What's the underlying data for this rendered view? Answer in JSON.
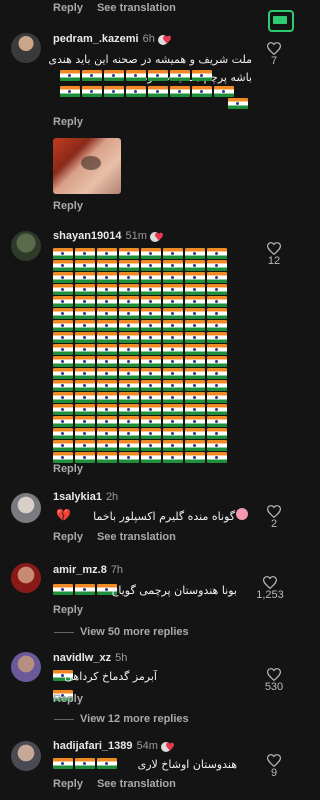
{
  "top": {
    "reply": "Reply",
    "see_translation": "See translation"
  },
  "comments": [
    {
      "username": "pedram_.kazemi",
      "time": "6h",
      "text_lines": [
        "ملت شریف و همیشه در صحنه این باید هندی",
        "باشه پرچم هند یادت نره"
      ],
      "likes": "7",
      "reply": "Reply"
    },
    {
      "username": "",
      "image_caption": "",
      "reply": "Reply"
    },
    {
      "username": "shayan19014",
      "time": "51m",
      "likes": "12",
      "reply": "Reply"
    },
    {
      "username": "1salykia1",
      "time": "2h",
      "text": "گوناه منده گلیرم اکسپلور باخما",
      "likes": "2",
      "reply": "Reply",
      "see_translation": "See translation"
    },
    {
      "username": "amir_mz.8",
      "time": "7h",
      "text": "بونا هندوستان پرچمی گویاخ",
      "likes": "1,253",
      "reply": "Reply",
      "view_more": "View 50 more replies"
    },
    {
      "username": "navidlw_xz",
      "time": "5h",
      "text": "آبرمز گدماخ کرداهی",
      "likes": "530",
      "reply": "Reply",
      "view_more": "View 12 more replies"
    },
    {
      "username": "hadijafari_1389",
      "time": "54m",
      "text": "هندوستان اوشاخ لاری",
      "likes": "9",
      "reply": "Reply",
      "see_translation": "See translation"
    }
  ],
  "colors": {
    "background": "#141414",
    "accent_badge": "#2ecc71"
  },
  "icons": [
    "heart-icon",
    "translate-badge-icon",
    "verified-badge-icon"
  ]
}
